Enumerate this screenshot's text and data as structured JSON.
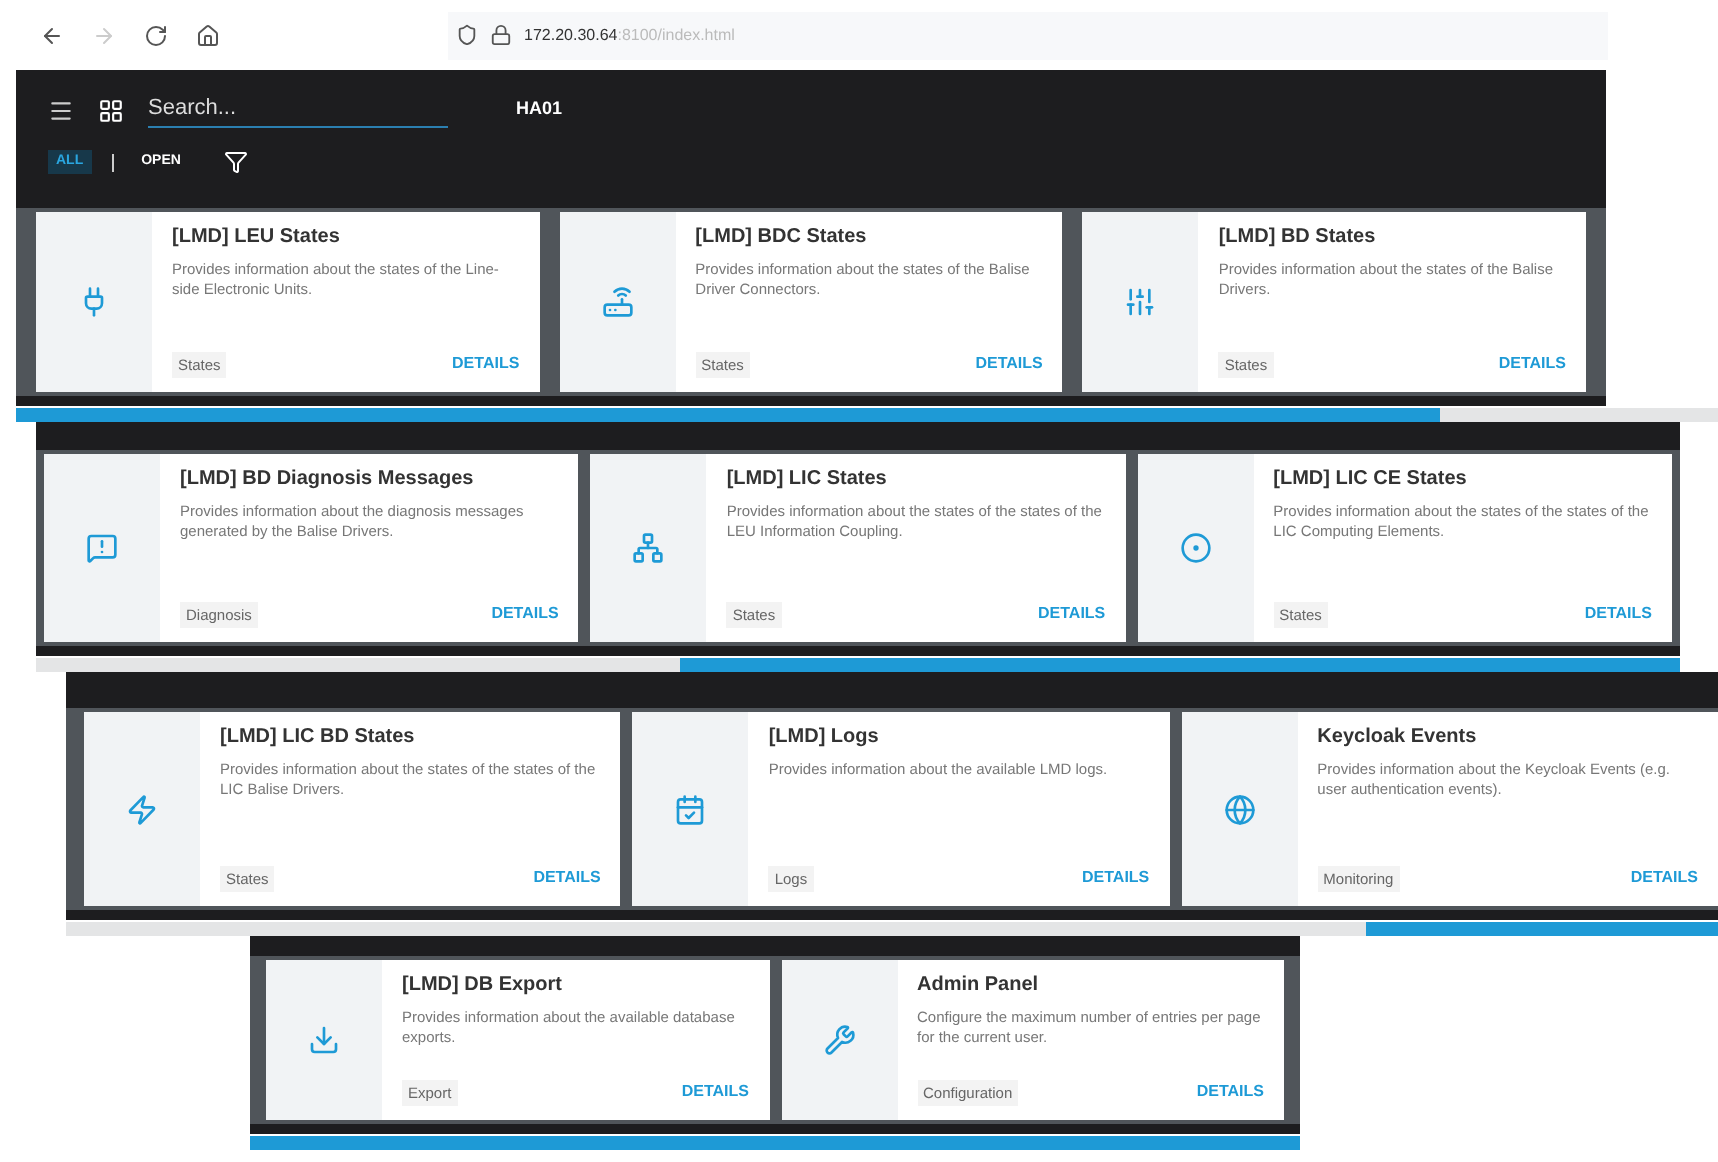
{
  "browser": {
    "url_host": "172.20.30.64",
    "url_path": ":8100/index.html"
  },
  "header": {
    "search": {
      "placeholder": "Search..."
    },
    "title": "HA01",
    "filters": [
      {
        "label": "ALL",
        "selected": true
      },
      {
        "label": "OPEN",
        "selected": false
      }
    ]
  },
  "rows": [
    {
      "cards": [
        {
          "title": "[LMD] LEU States",
          "description": "Provides information about the states of the Line-side Electronic Units.",
          "tag": "States",
          "action": "DETAILS"
        },
        {
          "title": "[LMD] BDC States",
          "description": "Provides information about the states of the Balise Driver Connectors.",
          "tag": "States",
          "action": "DETAILS"
        },
        {
          "title": "[LMD] BD States",
          "description": "Provides information about the states of the Balise Drivers.",
          "tag": "States",
          "action": "DETAILS"
        }
      ]
    },
    {
      "cards": [
        {
          "title": "[LMD] BD Diagnosis Messages",
          "description": "Provides information about the diagnosis messages generated by the Balise Drivers.",
          "tag": "Diagnosis",
          "action": "DETAILS"
        },
        {
          "title": "[LMD] LIC States",
          "description": "Provides information about the states of the states of the LEU Information Coupling.",
          "tag": "States",
          "action": "DETAILS"
        },
        {
          "title": "[LMD] LIC CE States",
          "description": "Provides information about the states of the states of the LIC Computing Elements.",
          "tag": "States",
          "action": "DETAILS"
        }
      ]
    },
    {
      "cards": [
        {
          "title": "[LMD] LIC BD States",
          "description": "Provides information about the states of the states of the LIC Balise Drivers.",
          "tag": "States",
          "action": "DETAILS"
        },
        {
          "title": "[LMD] Logs",
          "description": "Provides information about the available LMD logs.",
          "tag": "Logs",
          "action": "DETAILS"
        },
        {
          "title": "Keycloak Events",
          "description": "Provides information about the Keycloak Events (e.g. user authentication events).",
          "tag": "Monitoring",
          "action": "DETAILS"
        }
      ]
    },
    {
      "cards": [
        {
          "title": "[LMD] DB Export",
          "description": "Provides information about the available database exports.",
          "tag": "Export",
          "action": "DETAILS"
        },
        {
          "title": "Admin Panel",
          "description": "Configure the maximum number of entries per page for the current user.",
          "tag": "Configuration",
          "action": "DETAILS"
        }
      ]
    }
  ]
}
